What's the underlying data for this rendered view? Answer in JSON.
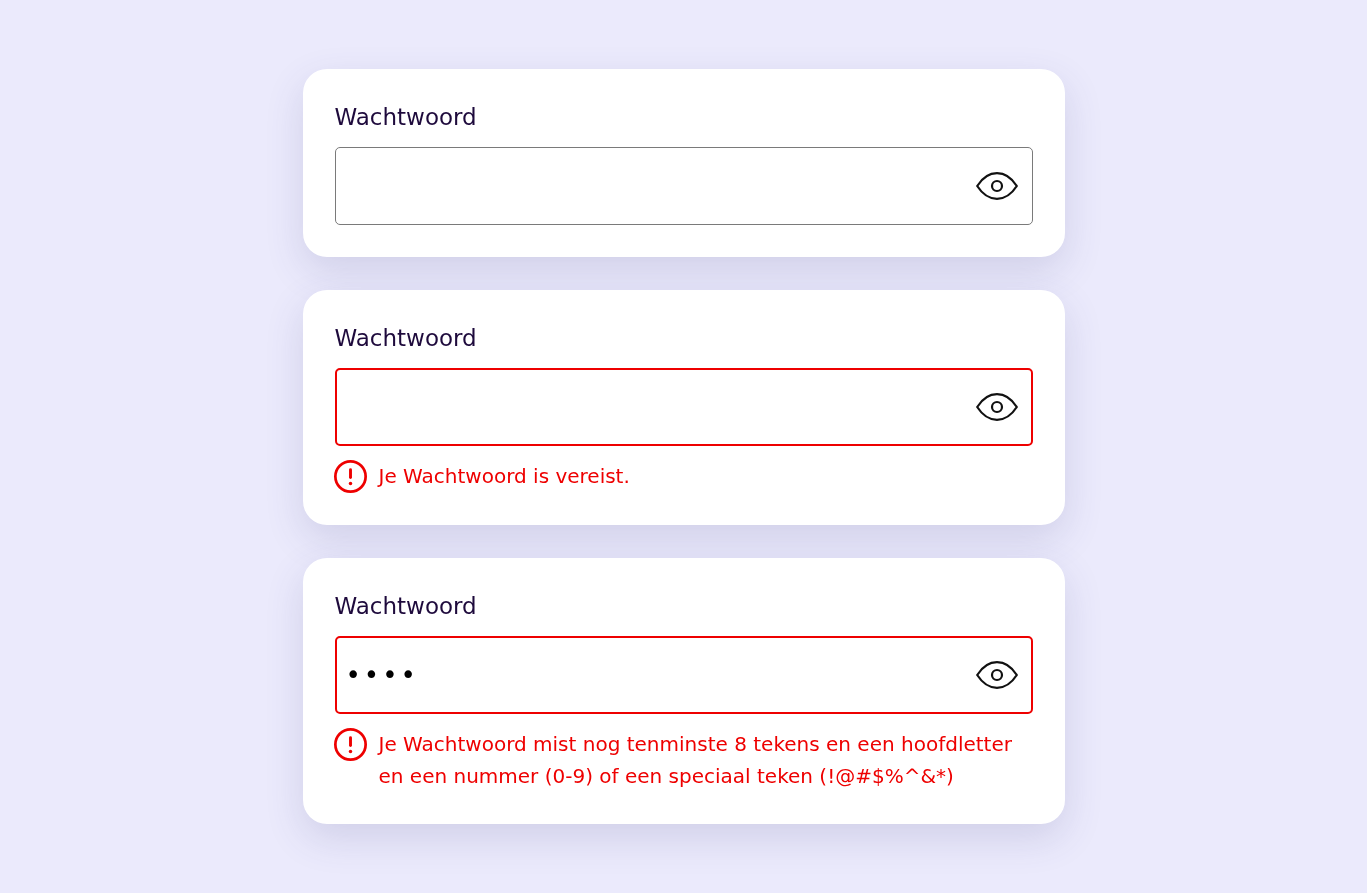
{
  "fields": [
    {
      "label": "Wachtwoord",
      "invalid": false
    },
    {
      "label": "Wachtwoord",
      "invalid": true,
      "error": "Je Wachtwoord is vereist."
    },
    {
      "label": "Wachtwoord",
      "value": "••••",
      "invalid": true,
      "error": "Je Wachtwoord mist nog tenminste 8 tekens en een hoofdletter en een nummer (0-9) of een speciaal teken (!@#$%^&*)"
    }
  ]
}
